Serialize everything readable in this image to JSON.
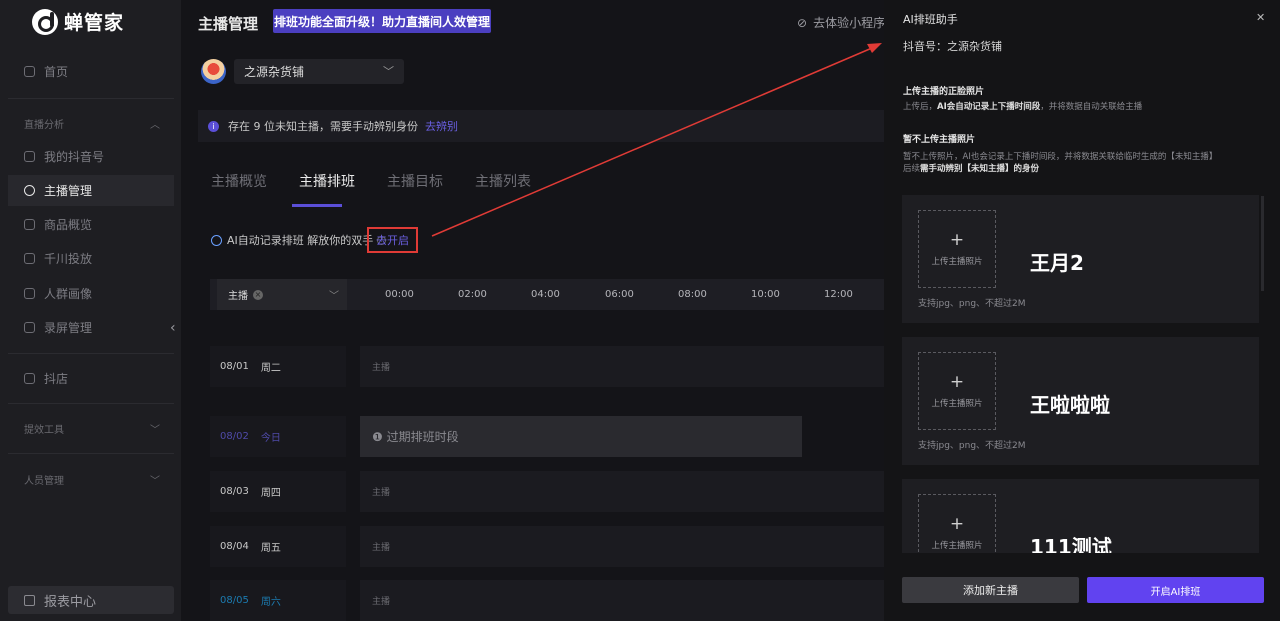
{
  "app": {
    "name": "蝉管家"
  },
  "sidebar": {
    "items": [
      {
        "label": "首页",
        "active": false
      },
      {
        "label": "我的抖音号",
        "active": false
      },
      {
        "label": "主播管理",
        "active": true
      },
      {
        "label": "商品概览",
        "active": false
      },
      {
        "label": "千川投放",
        "active": false
      },
      {
        "label": "人群画像",
        "active": false
      },
      {
        "label": "录屏管理",
        "active": false
      },
      {
        "label": "抖店",
        "active": false
      }
    ],
    "groups": [
      "直播分析",
      "提效工具",
      "人员管理"
    ],
    "report": "报表中心"
  },
  "header": {
    "title": "主播管理",
    "promo": "排班功能全面升级！助力直播间人效管理",
    "mini": "去体验小程序"
  },
  "store": {
    "name": "之源杂货铺"
  },
  "notice": {
    "text": "存在 9 位未知主播，需要手动辨别身份",
    "link": "去辨别"
  },
  "tabs": [
    {
      "label": "主播概览",
      "active": false
    },
    {
      "label": "主播排班",
      "active": true
    },
    {
      "label": "主播目标",
      "active": false
    },
    {
      "label": "主播列表",
      "active": false
    }
  ],
  "ai_record": {
    "text": "AI自动记录排班 解放你的双手",
    "button": "去开启"
  },
  "grid": {
    "anchor_select": "主播",
    "hours": [
      "00:00",
      "02:00",
      "04:00",
      "06:00",
      "08:00",
      "10:00",
      "12:00"
    ],
    "days": [
      {
        "date": "08/01",
        "weekday": "周二",
        "cell": "主播",
        "type": "normal"
      },
      {
        "date": "08/02",
        "weekday": "今日",
        "cell": "❶ 过期排班时段",
        "type": "today"
      },
      {
        "date": "08/03",
        "weekday": "周四",
        "cell": "主播",
        "type": "normal"
      },
      {
        "date": "08/04",
        "weekday": "周五",
        "cell": "主播",
        "type": "normal"
      },
      {
        "date": "08/05",
        "weekday": "周六",
        "cell": "主播",
        "type": "sat"
      }
    ]
  },
  "panel": {
    "title": "AI排班助手",
    "account": "抖音号：之源杂货铺",
    "upload_heading": "上传主播的正脸照片",
    "upload_desc_pre": "上传后，",
    "upload_desc_bold": "AI会自动记录上下播时间段",
    "upload_desc_post": "，并将数据自动关联给主播",
    "skip_heading": "暂不上传主播照片",
    "skip_desc_1": "暂不上传照片，AI也会记录上下播时间段，并将数据关联给临时生成的【未知主播】",
    "skip_desc_2_pre": "后续",
    "skip_desc_2_bold": "需手动辨别【未知主播】的身份",
    "anchors": [
      {
        "name": "王月2",
        "upload_label": "上传主播照片",
        "hint": "支持jpg、png、不超过2M"
      },
      {
        "name": "王啦啦啦",
        "upload_label": "上传主播照片",
        "hint": "支持jpg、png、不超过2M"
      },
      {
        "name": "111测试",
        "upload_label": "上传主播照片",
        "hint": "支持jpg、png、不超过2M"
      }
    ],
    "add_button": "添加新主播",
    "start_button": "开启AI排班"
  },
  "colors": {
    "accent": "#6143f0",
    "annotation": "#e03b36",
    "promo": "#4b3fc0"
  }
}
